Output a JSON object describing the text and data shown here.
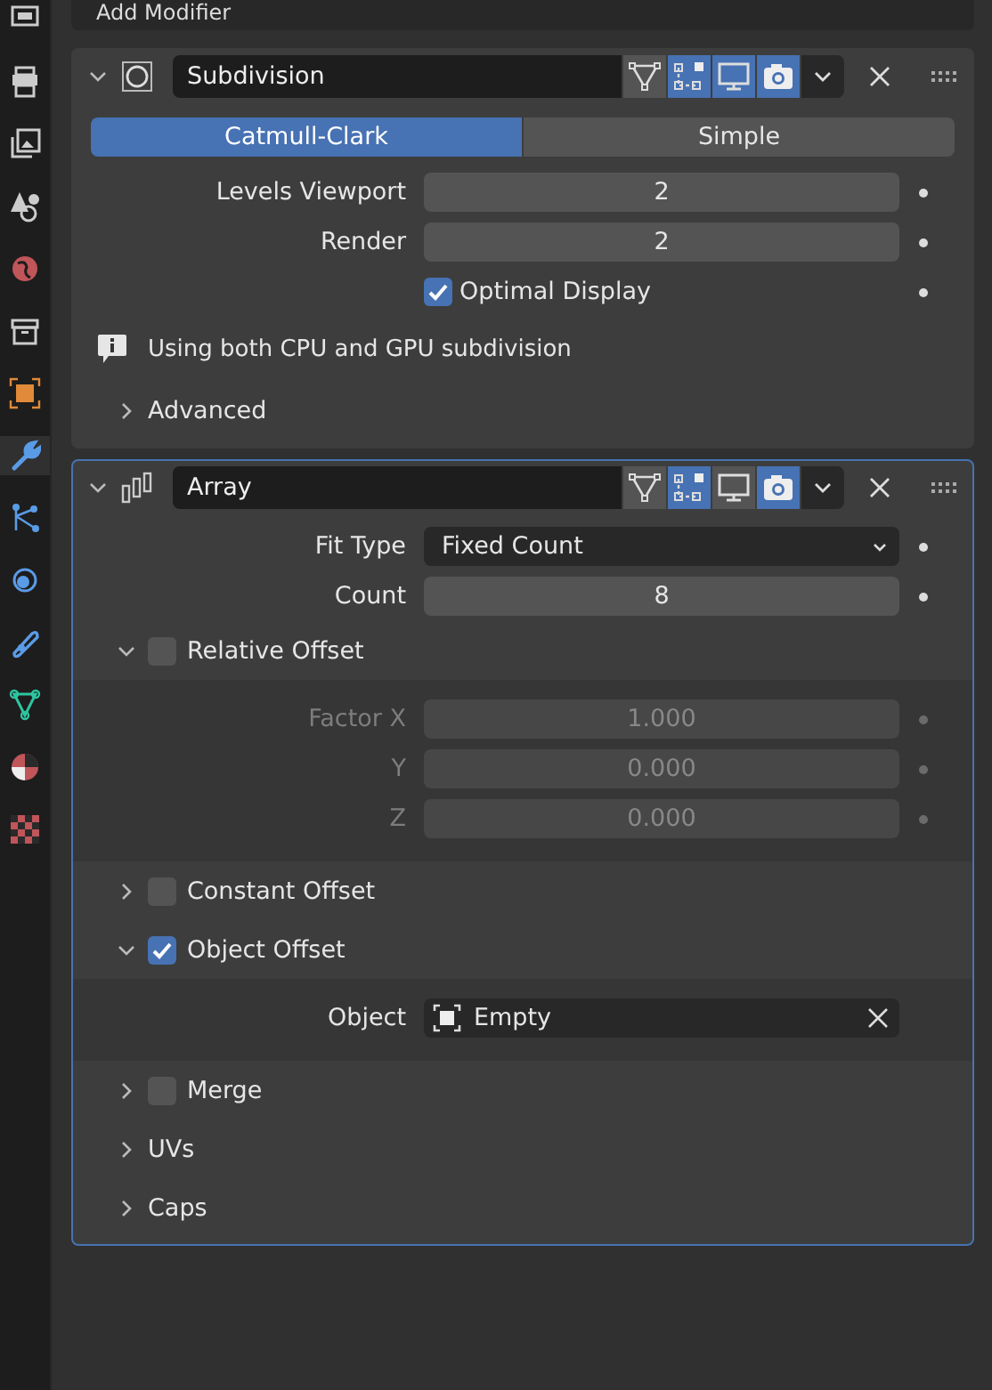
{
  "add_modifier": {
    "label": "Add Modifier"
  },
  "sidebar_tabs": [
    {
      "kind": "render",
      "selected": false
    },
    {
      "kind": "output",
      "selected": false
    },
    {
      "kind": "view-layer",
      "selected": false
    },
    {
      "kind": "scene",
      "selected": false
    },
    {
      "kind": "world",
      "selected": false
    },
    {
      "kind": "collection",
      "selected": false
    },
    {
      "kind": "object",
      "selected": false
    },
    {
      "kind": "modifier",
      "selected": true
    },
    {
      "kind": "particles",
      "selected": false
    },
    {
      "kind": "physics",
      "selected": false
    },
    {
      "kind": "constraints",
      "selected": false
    },
    {
      "kind": "data",
      "selected": false
    },
    {
      "kind": "material",
      "selected": false
    },
    {
      "kind": "texture",
      "selected": false
    }
  ],
  "modifiers": [
    {
      "kind": "subdivision",
      "name": "Subdivision",
      "expanded": true,
      "active": false,
      "toggles": [
        {
          "kind": "cage",
          "on": false
        },
        {
          "kind": "edit-mode",
          "on": true
        },
        {
          "kind": "viewport",
          "on": true
        },
        {
          "kind": "render",
          "on": true
        }
      ],
      "rows": [
        {
          "kind": "segmented",
          "options": [
            {
              "label": "Catmull-Clark",
              "selected": true
            },
            {
              "label": "Simple",
              "selected": false
            }
          ]
        },
        {
          "kind": "number",
          "label": "Levels Viewport",
          "value": "2",
          "disabled": false
        },
        {
          "kind": "number",
          "label": "Render",
          "value": "2",
          "disabled": false
        },
        {
          "kind": "checkbox",
          "label": "Optimal Display",
          "checked": true
        },
        {
          "kind": "info",
          "text": "Using both CPU and GPU subdivision"
        },
        {
          "kind": "subpanel",
          "label": "Advanced",
          "expanded": false
        }
      ]
    },
    {
      "kind": "array",
      "name": "Array",
      "expanded": true,
      "active": true,
      "toggles": [
        {
          "kind": "cage",
          "on": false
        },
        {
          "kind": "edit-mode",
          "on": true
        },
        {
          "kind": "viewport",
          "on": false
        },
        {
          "kind": "render",
          "on": true
        }
      ],
      "rows": [
        {
          "kind": "dropdown",
          "label": "Fit Type",
          "value": "Fixed Count"
        },
        {
          "kind": "number",
          "label": "Count",
          "value": "8",
          "disabled": false
        },
        {
          "kind": "subpanel",
          "label": "Relative Offset",
          "checked": false,
          "expanded": true,
          "rows": [
            {
              "kind": "number",
              "label": "Factor X",
              "value": "1.000",
              "disabled": true
            },
            {
              "kind": "number",
              "label": "Y",
              "value": "0.000",
              "disabled": true
            },
            {
              "kind": "number",
              "label": "Z",
              "value": "0.000",
              "disabled": true
            }
          ]
        },
        {
          "kind": "subpanel",
          "label": "Constant Offset",
          "checked": false,
          "expanded": false
        },
        {
          "kind": "subpanel",
          "label": "Object Offset",
          "checked": true,
          "expanded": true,
          "rows": [
            {
              "kind": "object",
              "label": "Object",
              "value": "Empty"
            }
          ]
        },
        {
          "kind": "subpanel",
          "label": "Merge",
          "checked": false,
          "expanded": false
        },
        {
          "kind": "subpanel",
          "label": "UVs",
          "expanded": false
        },
        {
          "kind": "subpanel",
          "label": "Caps",
          "expanded": false
        }
      ]
    }
  ]
}
